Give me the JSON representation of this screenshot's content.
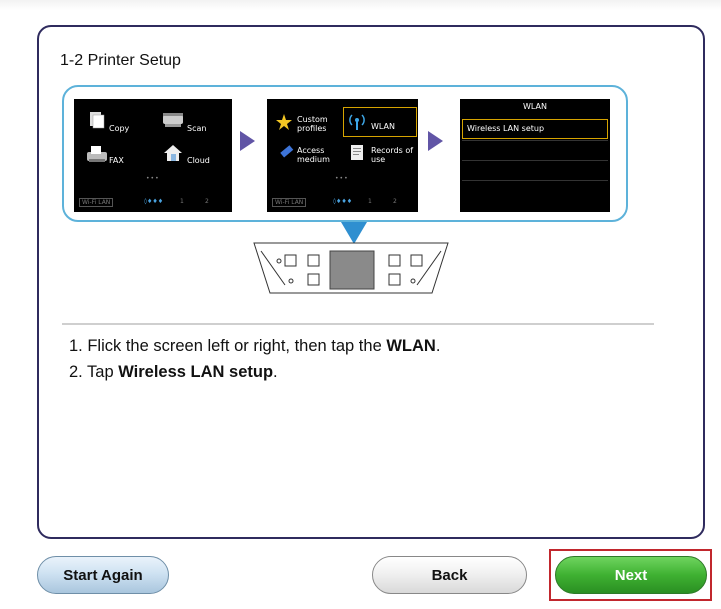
{
  "panel": {
    "title": "1-2 Printer Setup"
  },
  "screens": {
    "home": {
      "copy": "Copy",
      "scan": "Scan",
      "fax": "FAX",
      "cloud": "Cloud",
      "wifi_lan": "Wi-Fi LAN",
      "ink": "◊♦♦♦",
      "paper1": "1",
      "paper2": "2"
    },
    "menu": {
      "custom_profiles_1": "Custom",
      "custom_profiles_2": "profiles",
      "wlan": "WLAN",
      "access_medium_1": "Access",
      "access_medium_2": "medium",
      "records_1": "Records of",
      "records_2": "use",
      "wifi_lan": "Wi-Fi LAN",
      "ink": "◊♦♦♦",
      "paper1": "1",
      "paper2": "2"
    },
    "wlan": {
      "title": "WLAN",
      "item": "Wireless LAN setup"
    }
  },
  "instructions": {
    "step1_prefix": "1. Flick the screen left or right, then tap the ",
    "step1_bold": "WLAN",
    "step1_suffix": ".",
    "step2_prefix": "2. Tap ",
    "step2_bold": "Wireless LAN setup",
    "step2_suffix": "."
  },
  "buttons": {
    "start_again": "Start Again",
    "back": "Back",
    "next": "Next"
  },
  "colors": {
    "accent_border": "#2f2b5e",
    "flow_border": "#5db2da",
    "arrow": "#6155a6",
    "down_arrow": "#2f8fd0",
    "next_green": "#3fb132",
    "highlight_frame": "#c1272d",
    "wlan_highlight": "#d6a400"
  },
  "icons": {
    "copy": "copy-icon",
    "scan": "scanner-icon",
    "fax": "fax-icon",
    "cloud": "cloud-icon",
    "custom_profiles": "star-icon",
    "wlan": "wireless-antenna-icon",
    "access_medium": "usb-stick-icon",
    "records": "document-icon"
  }
}
